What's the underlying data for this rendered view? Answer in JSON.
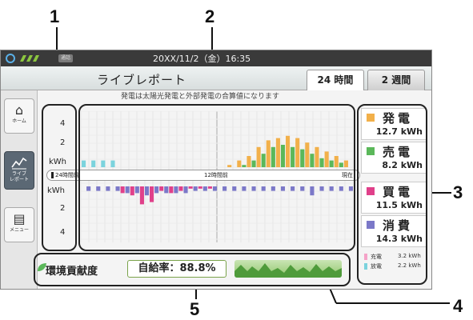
{
  "callouts": {
    "one": "1",
    "two": "2",
    "three": "3",
    "four": "4",
    "five": "5"
  },
  "status_bar": {
    "datetime": "20XX/11/2（金）16:35",
    "chip_text": "通話"
  },
  "header": {
    "title": "ライブレポート",
    "tab_24h": "24 時間",
    "tab_2w": "2 週間"
  },
  "chart_note": "発電は太陽光発電と外部発電の合算値になります",
  "sidebar": {
    "home": "ホーム",
    "live": "ライブ\nレポート",
    "menu": "メニュー"
  },
  "axis": {
    "top_values": [
      "4",
      "2"
    ],
    "unit_top": "kWh",
    "unit_bottom": "kWh",
    "bottom_values": [
      "2",
      "4"
    ]
  },
  "slider": {
    "start": "24時間前",
    "mid": "12時間前",
    "end": "現在"
  },
  "legend": {
    "generation": {
      "name": "発電",
      "value": "12.7 kWh",
      "color": "#f2b04a"
    },
    "sell": {
      "name": "売電",
      "value": "8.2 kWh",
      "color": "#5bb85a"
    },
    "buy": {
      "name": "買電",
      "value": "11.5 kWh",
      "color": "#e0408a"
    },
    "consume": {
      "name": "消費",
      "value": "14.3 kWh",
      "color": "#7b78c8"
    },
    "charge_label": "充電",
    "charge_value": "3.2 kWh",
    "charge_color": "#f5a3c8",
    "discharge_label": "放電",
    "discharge_value": "2.2 kWh",
    "discharge_color": "#7bd3dd"
  },
  "eco": {
    "label": "環境貢献度",
    "rate": "自給率：88.8%"
  },
  "chart_data": {
    "type": "bar",
    "series": [
      {
        "name": "発電",
        "values": [
          0,
          0,
          0,
          0,
          0,
          0,
          0,
          0,
          0,
          0,
          0,
          0,
          0,
          0,
          0,
          0.2,
          0.6,
          1.0,
          1.8,
          2.4,
          2.6,
          2.8,
          2.6,
          2.2,
          1.8,
          1.4,
          1.0,
          0.6
        ],
        "color": "#f2b04a"
      },
      {
        "name": "売電",
        "values": [
          0,
          0,
          0,
          0,
          0,
          0,
          0,
          0,
          0,
          0,
          0,
          0,
          0,
          0,
          0,
          0,
          0.2,
          0.6,
          1.2,
          1.8,
          2.0,
          1.8,
          1.6,
          1.2,
          0.8,
          0.6,
          0.4,
          0
        ],
        "color": "#5bb85a"
      },
      {
        "name": "買電",
        "values": [
          0,
          0,
          0,
          0,
          0.6,
          0.8,
          1.6,
          1.4,
          0.4,
          0.6,
          0.4,
          0.2,
          0.2,
          0.2,
          0,
          0,
          0,
          0,
          0,
          0,
          0,
          0,
          0,
          0,
          0,
          0,
          0,
          0
        ],
        "color": "#e0408a"
      },
      {
        "name": "消費",
        "values": [
          0.4,
          0.4,
          0.4,
          0.4,
          0.6,
          0.6,
          0.8,
          0.6,
          0.6,
          0.6,
          0.6,
          0.4,
          0.4,
          0.4,
          0.4,
          0.4,
          0.4,
          0.4,
          0.4,
          0.4,
          0.4,
          0.4,
          0.4,
          0.8,
          0.4,
          0.4,
          0.4,
          0.4
        ],
        "color": "#7b78c8"
      },
      {
        "name": "放電",
        "values": [
          0.6,
          0.6,
          0.6,
          0.6,
          0,
          0,
          0,
          0,
          0,
          0,
          0,
          0,
          0,
          0,
          0,
          0,
          0,
          0,
          0,
          0,
          0,
          0,
          0,
          0,
          0,
          0,
          0,
          0
        ],
        "color": "#7bd3dd"
      }
    ],
    "ylim": [
      -5,
      5
    ]
  }
}
